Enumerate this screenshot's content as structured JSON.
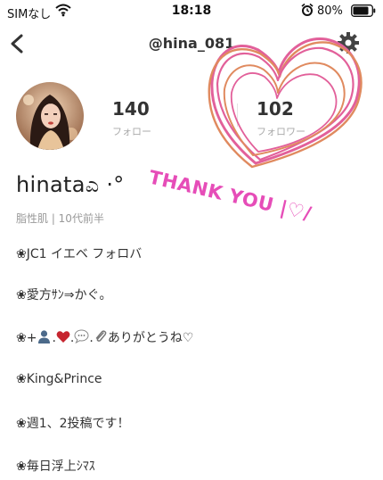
{
  "status_bar": {
    "carrier": "SIMなし",
    "time": "18:18",
    "battery": "80%"
  },
  "header": {
    "username": "@hina_081"
  },
  "profile": {
    "following_count": "140",
    "following_label": "フォロー",
    "followers_count": "102",
    "followers_label": "フォロワー",
    "display_name": "hinataಎ ·°",
    "tags": "脂性肌 | 10代前半"
  },
  "bio": {
    "line1": "❀JC1 イエベ フォロバ",
    "line2": "❀愛方ｻﾝ⇒かぐ。",
    "line3_prefix": "❀+",
    "line3_suffix": "ありがとうね♡",
    "line4": "❀King&Prince",
    "line5": "❀週1、2投稿です！",
    "line6": "❀毎日浮上ｼﾏｽ"
  },
  "overlay_text": {
    "message": "THANK YOU |♡/"
  },
  "colors": {
    "heart_pink": "#e2609a",
    "heart_orange": "#e08a5f",
    "text_pink": "#e64db8"
  },
  "icons": [
    "back-arrow-icon",
    "wifi-icon",
    "alarm-icon",
    "battery-icon",
    "gear-icon"
  ]
}
